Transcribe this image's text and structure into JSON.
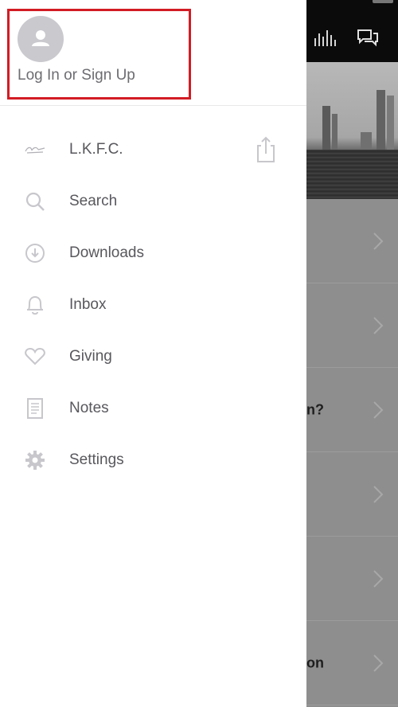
{
  "drawer": {
    "profile": {
      "login_label": "Log In or Sign Up",
      "avatar_icon": "person-icon"
    },
    "items": [
      {
        "label": "L.K.F.C.",
        "icon": "church-logo"
      },
      {
        "label": "Search",
        "icon": "search-icon"
      },
      {
        "label": "Downloads",
        "icon": "download-icon"
      },
      {
        "label": "Inbox",
        "icon": "bell-icon"
      },
      {
        "label": "Giving",
        "icon": "heart-icon"
      },
      {
        "label": "Notes",
        "icon": "notes-icon"
      },
      {
        "label": "Settings",
        "icon": "gear-icon"
      }
    ]
  },
  "background": {
    "rows": [
      "",
      "",
      "n?",
      "",
      "",
      "on"
    ]
  },
  "colors": {
    "highlight": "#d31c24",
    "icon": "#c7c7cc",
    "label": "#58585d"
  }
}
